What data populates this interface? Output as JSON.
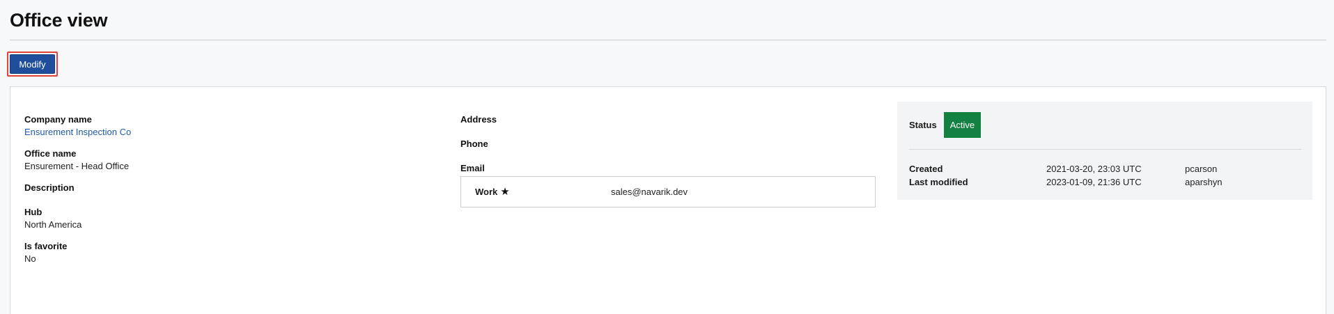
{
  "page": {
    "title": "Office view"
  },
  "toolbar": {
    "modify_label": "Modify"
  },
  "details": {
    "company_name_label": "Company name",
    "company_name_value": "Ensurement Inspection Co",
    "office_name_label": "Office name",
    "office_name_value": "Ensurement - Head Office",
    "description_label": "Description",
    "hub_label": "Hub",
    "hub_value": "North America",
    "is_favorite_label": "Is favorite",
    "is_favorite_value": "No"
  },
  "contact": {
    "address_label": "Address",
    "phone_label": "Phone",
    "email_label": "Email",
    "emails": [
      {
        "type": "Work",
        "primary_icon": "star-icon",
        "address": "sales@navarik.dev"
      }
    ]
  },
  "status_panel": {
    "status_label": "Status",
    "status_value": "Active",
    "status_color": "#138240",
    "created_label": "Created",
    "created_date": "2021-03-20, 23:03 UTC",
    "created_user": "pcarson",
    "modified_label": "Last modified",
    "modified_date": "2023-01-09, 21:36 UTC",
    "modified_user": "aparshyn"
  },
  "colors": {
    "primary_button": "#1f4f9c",
    "link": "#1f5aa8",
    "focus_ring": "#e0413a"
  }
}
